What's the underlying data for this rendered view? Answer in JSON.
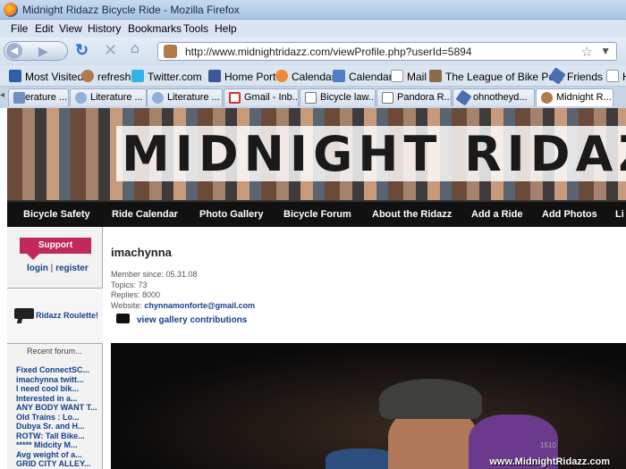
{
  "window": {
    "title": "Midnight Ridazz Bicycle Ride - Mozilla Firefox",
    "icon": "firefox-icon"
  },
  "menu": [
    "File",
    "Edit",
    "View",
    "History",
    "Bookmarks",
    "Tools",
    "Help"
  ],
  "nav": {
    "url": "http://www.midnightridazz.com/viewProfile.php?userId=5894"
  },
  "bookmarks": [
    "Most Visited",
    "refresh",
    "Twitter.com",
    "Home Port",
    "Calendar",
    "Calendar",
    "Mail",
    "The League of Bike Po...",
    "Friends",
    "H"
  ],
  "tabs": [
    "erature ...",
    "Literature ...",
    "Literature ...",
    "Gmail - Inb...",
    "Bicycle law...",
    "Pandora R...",
    "ohnotheyd...",
    "Midnight R..."
  ],
  "site": {
    "logo": "MIDNIGHT RIDAZ",
    "nav_items": [
      "Bicycle Safety",
      "Ride Calendar",
      "Photo Gallery",
      "Bicycle Forum",
      "About the Ridazz",
      "Add a Ride",
      "Add Photos",
      "Li"
    ],
    "sidebar": {
      "support": "Support",
      "login": "login",
      "separator": "|",
      "register": "register",
      "roulette": "Ridazz Roulette!",
      "recent_title": "Recent forum...",
      "recent": [
        "Fixed ConnectSC...",
        "imachynna twitt...",
        "I need cool bik...",
        "Interested in a...",
        "ANY BODY WANT T...",
        "Old Trains : Lo...",
        "Dubya Sr. and H...",
        "ROTW: Tall Bike...",
        "***** Midcity M...",
        "Avg weight of a...",
        "GRID CITY ALLEY..."
      ]
    },
    "profile": {
      "username": "imachynna",
      "member_since": "Member since: 05.31.08",
      "topics": "Topics: 73",
      "replies": "Replies: 8000",
      "website_label": "Website:",
      "website": "chynnamonforte@gmail.com",
      "gallery_link": "view gallery contributions",
      "photo_sign": "1510"
    },
    "watermark": "www.MidnightRidazz.com"
  }
}
